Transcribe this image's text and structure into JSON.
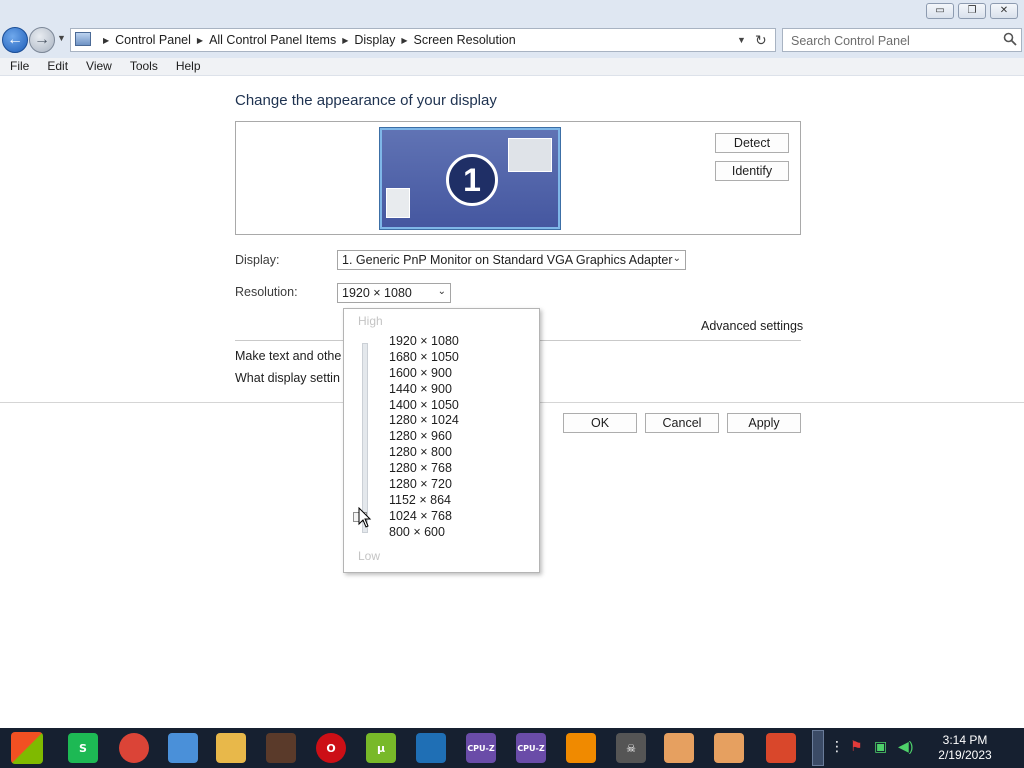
{
  "window": {
    "minimize_label": "▭",
    "restore_label": "❐",
    "close_label": "✕"
  },
  "address": {
    "breadcrumbs": [
      "Control Panel",
      "All Control Panel Items",
      "Display",
      "Screen Resolution"
    ],
    "search_placeholder": "Search Control Panel"
  },
  "menu": [
    "File",
    "Edit",
    "View",
    "Tools",
    "Help"
  ],
  "page": {
    "heading": "Change the appearance of your display",
    "monitor_number": "1",
    "detect_label": "Detect",
    "identify_label": "Identify",
    "display_label": "Display:",
    "display_value": "1. Generic PnP Monitor on Standard VGA Graphics Adapter",
    "resolution_label": "Resolution:",
    "resolution_value": "1920 × 1080",
    "advanced_label": "Advanced settings",
    "link_text_size": "Make text and othe",
    "link_display_settings": "What display settin",
    "ok_label": "OK",
    "cancel_label": "Cancel",
    "apply_label": "Apply"
  },
  "resolution_popup": {
    "high_label": "High",
    "low_label": "Low",
    "options": [
      "1920 × 1080",
      "1680 × 1050",
      "1600 × 900",
      "1440 × 900",
      "1400 × 1050",
      "1280 × 1024",
      "1280 × 960",
      "1280 × 800",
      "1280 × 768",
      "1280 × 720",
      "1152 × 864",
      "1024 × 768",
      "800 × 600"
    ],
    "slider_position_option": "1024 × 768"
  },
  "taskbar": {
    "apps": [
      {
        "name": "start",
        "label": "",
        "color": "#f25022"
      },
      {
        "name": "spotify",
        "label": "S",
        "color": "#1db954"
      },
      {
        "name": "chrome",
        "label": "",
        "color": "#db4437"
      },
      {
        "name": "network",
        "label": "",
        "color": "#4a90d9"
      },
      {
        "name": "file-explorer",
        "label": "",
        "color": "#e8b84a"
      },
      {
        "name": "portrait",
        "label": "",
        "color": "#5a3a2a"
      },
      {
        "name": "opera",
        "label": "O",
        "color": "#cc0f16"
      },
      {
        "name": "utorrent",
        "label": "µ",
        "color": "#78b929"
      },
      {
        "name": "virtualbox",
        "label": "",
        "color": "#1f6fb5"
      },
      {
        "name": "cpuz-a",
        "label": "CPU-Z",
        "color": "#6a4ca8"
      },
      {
        "name": "cpuz-b",
        "label": "CPU-Z",
        "color": "#6a4ca8"
      },
      {
        "name": "vlc",
        "label": "",
        "color": "#f08a00"
      },
      {
        "name": "skull",
        "label": "☠",
        "color": "#555555"
      },
      {
        "name": "user-a",
        "label": "",
        "color": "#e6a060"
      },
      {
        "name": "user-b",
        "label": "",
        "color": "#e6a060"
      },
      {
        "name": "ccleaner",
        "label": "",
        "color": "#d9472b"
      }
    ],
    "time": "3:14 PM",
    "date": "2/19/2023"
  }
}
